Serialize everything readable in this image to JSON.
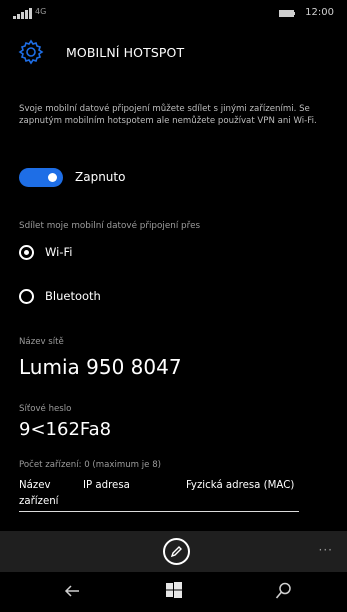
{
  "statusbar": {
    "network_label": "4G",
    "time": "12:00",
    "signal_icon": "signal-icon",
    "battery_icon": "battery-icon"
  },
  "header": {
    "title": "MOBILNÍ HOTSPOT",
    "icon": "gear-icon",
    "accent_color": "#1e6ee6"
  },
  "description": "Svoje mobilní datové připojení můžete sdílet s jinými zařízeními. Se zapnutým mobilním hotspotem ale nemůžete používat VPN ani Wi-Fi.",
  "hotspot_toggle": {
    "label": "Zapnuto",
    "on": true
  },
  "share_via": {
    "label": "Sdílet moje mobilní datové připojení přes",
    "options": [
      {
        "label": "Wi-Fi",
        "selected": true
      },
      {
        "label": "Bluetooth",
        "selected": false
      }
    ]
  },
  "network_name": {
    "label": "Název sítě",
    "value": "Lumia 950 8047"
  },
  "network_password": {
    "label": "Síťové heslo",
    "value": "9<162Fa8"
  },
  "devices": {
    "count_text": "Počet zařízení: 0 (maximum je 8)",
    "columns": [
      "Název zařízení",
      "IP adresa",
      "Fyzická adresa (MAC)"
    ]
  },
  "appbar": {
    "edit_icon": "edit-icon",
    "more_label": "···"
  },
  "navbar": {
    "back_icon": "back-arrow-icon",
    "start_icon": "windows-start-icon",
    "search_icon": "search-icon"
  }
}
